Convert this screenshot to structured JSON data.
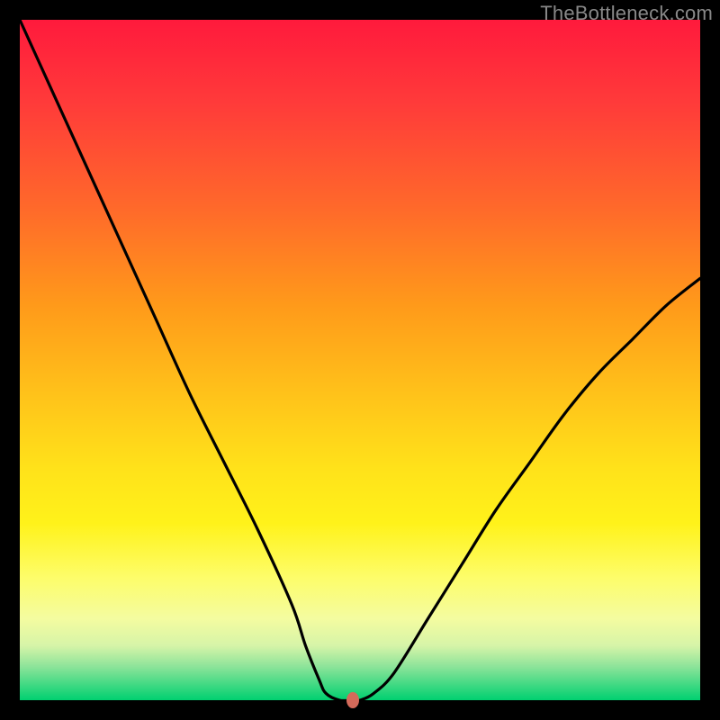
{
  "watermark": "TheBottleneck.com",
  "colors": {
    "frame": "#000000",
    "gradient_top": "#ff1a3c",
    "gradient_bottom": "#00d070",
    "curve": "#000000",
    "marker": "#d46a5a"
  },
  "chart_data": {
    "type": "line",
    "title": "",
    "xlabel": "",
    "ylabel": "",
    "xlim": [
      0,
      100
    ],
    "ylim": [
      0,
      100
    ],
    "grid": false,
    "legend": false,
    "series": [
      {
        "name": "curve",
        "x": [
          0,
          5,
          10,
          15,
          20,
          25,
          30,
          35,
          40,
          42,
          44,
          45,
          47,
          49,
          50,
          52,
          55,
          60,
          65,
          70,
          75,
          80,
          85,
          90,
          95,
          100
        ],
        "y": [
          100,
          89,
          78,
          67,
          56,
          45,
          35,
          25,
          14,
          8,
          3,
          1,
          0,
          0,
          0,
          1,
          4,
          12,
          20,
          28,
          35,
          42,
          48,
          53,
          58,
          62
        ]
      }
    ],
    "marker": {
      "x": 49,
      "y": 0
    }
  }
}
